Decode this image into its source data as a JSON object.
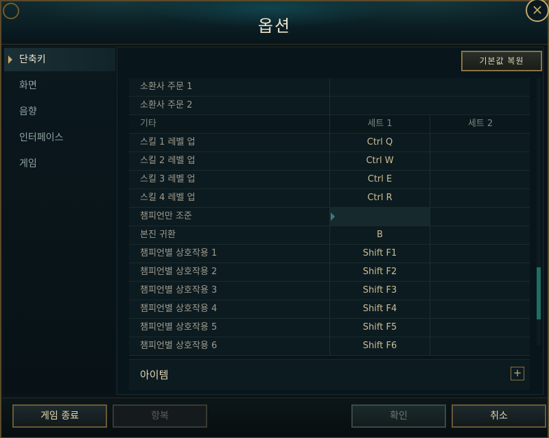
{
  "window": {
    "title": "옵션",
    "close_label": "×"
  },
  "sidebar": {
    "items": [
      {
        "label": "단축키",
        "active": true
      },
      {
        "label": "화면",
        "active": false
      },
      {
        "label": "음향",
        "active": false
      },
      {
        "label": "인터페이스",
        "active": false
      },
      {
        "label": "게임",
        "active": false
      }
    ]
  },
  "main": {
    "restore_label": "기본값 복원",
    "rows_top": [
      {
        "name": "소환사 주문 1",
        "s1": ""
      },
      {
        "name": "소환사 주문 2",
        "s1": ""
      }
    ],
    "table_header": {
      "name": "기타",
      "s1": "세트 1",
      "s2": "세트 2"
    },
    "rows": [
      {
        "name": "스킬 1 레벨 업",
        "s1": "Ctrl  Q",
        "s2": ""
      },
      {
        "name": "스킬 2 레벨 업",
        "s1": "Ctrl  W",
        "s2": ""
      },
      {
        "name": "스킬 3 레벨 업",
        "s1": "Ctrl  E",
        "s2": ""
      },
      {
        "name": "스킬 4 레벨 업",
        "s1": "Ctrl  R",
        "s2": ""
      },
      {
        "name": "챔피언만 조준",
        "s1": "",
        "s2": ""
      },
      {
        "name": "본진 귀환",
        "s1": "B",
        "s2": ""
      },
      {
        "name": "챔피언별 상호작용 1",
        "s1": "Shift  F1",
        "s2": ""
      },
      {
        "name": "챔피언별 상호작용 2",
        "s1": "Shift  F2",
        "s2": ""
      },
      {
        "name": "챔피언별 상호작용 3",
        "s1": "Shift  F3",
        "s2": ""
      },
      {
        "name": "챔피언별 상호작용 4",
        "s1": "Shift  F4",
        "s2": ""
      },
      {
        "name": "챔피언별 상호작용 5",
        "s1": "Shift  F5",
        "s2": ""
      },
      {
        "name": "챔피언별 상호작용 6",
        "s1": "Shift  F6",
        "s2": ""
      }
    ],
    "items_section": {
      "label": "아이템",
      "expand_label": "+"
    }
  },
  "footer": {
    "exit_label": "게임 종료",
    "item_label": "항복",
    "confirm_label": "확인",
    "cancel_label": "취소"
  }
}
